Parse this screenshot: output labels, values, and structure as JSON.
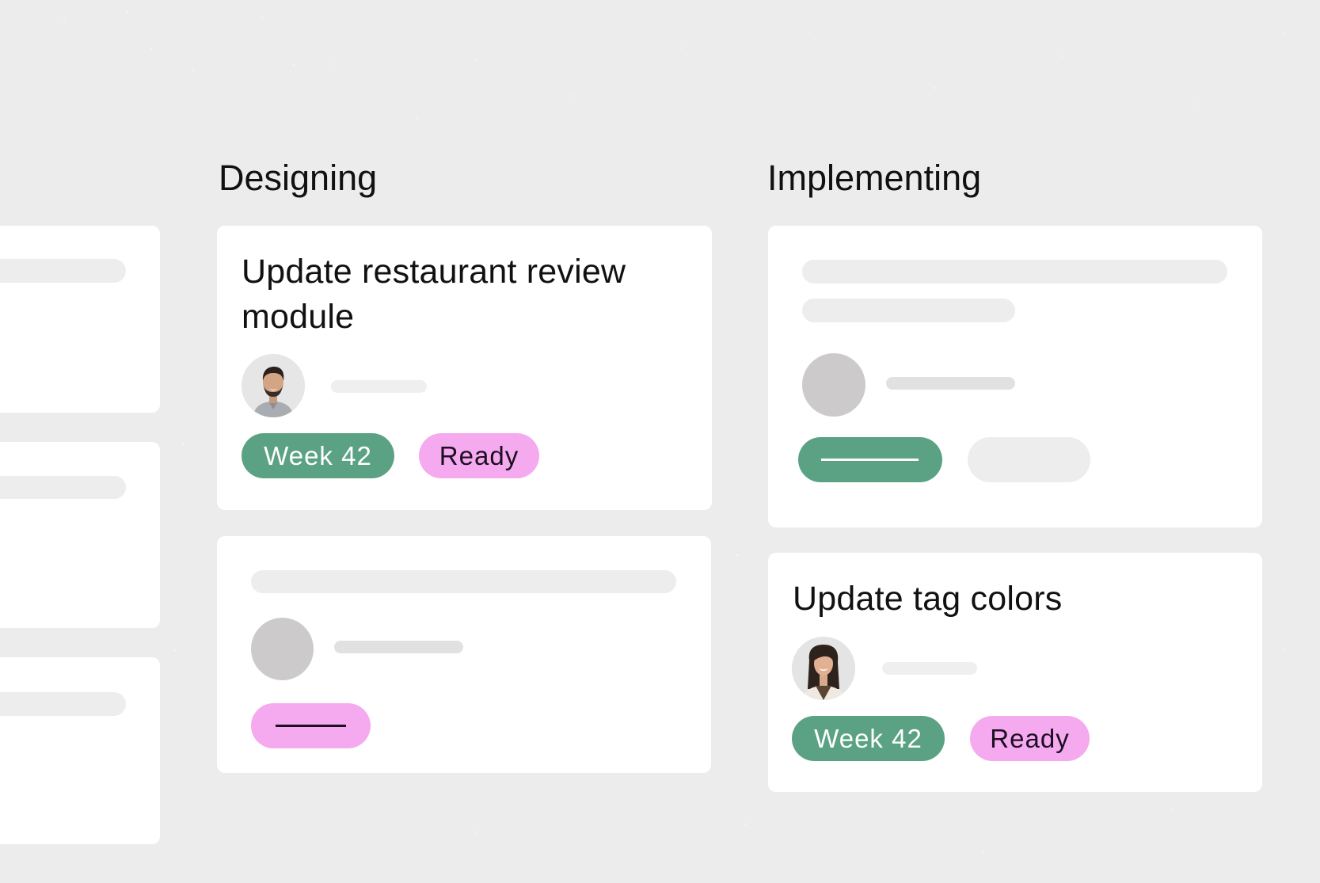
{
  "board": {
    "columns": [
      {
        "id": "designing",
        "heading": "Designing",
        "cards": [
          {
            "title": "Update restaurant review module",
            "assignee_avatar": "man-avatar",
            "tags": [
              {
                "label": "Week 42",
                "color": "#5ba284"
              },
              {
                "label": "Ready",
                "color": "#f5a9ee"
              }
            ]
          },
          {
            "title": null,
            "assignee_avatar": "placeholder-avatar",
            "tags": [
              {
                "label": null,
                "color": "#f5a9ee"
              }
            ]
          }
        ]
      },
      {
        "id": "implementing",
        "heading": "Implementing",
        "cards": [
          {
            "title": null,
            "assignee_avatar": "placeholder-avatar",
            "tags": [
              {
                "label": null,
                "color": "#5ba284"
              },
              {
                "label": null,
                "color": "#ededed"
              }
            ]
          },
          {
            "title": "Update tag colors",
            "assignee_avatar": "woman-avatar",
            "tags": [
              {
                "label": "Week 42",
                "color": "#5ba284"
              },
              {
                "label": "Ready",
                "color": "#f5a9ee"
              }
            ]
          }
        ]
      }
    ]
  },
  "colors": {
    "background": "#ececec",
    "card": "#ffffff",
    "tag_green": "#5ba284",
    "tag_pink": "#f5a9ee",
    "skeleton": "#ededed",
    "placeholder_avatar": "#cccacb",
    "text": "#111111"
  }
}
